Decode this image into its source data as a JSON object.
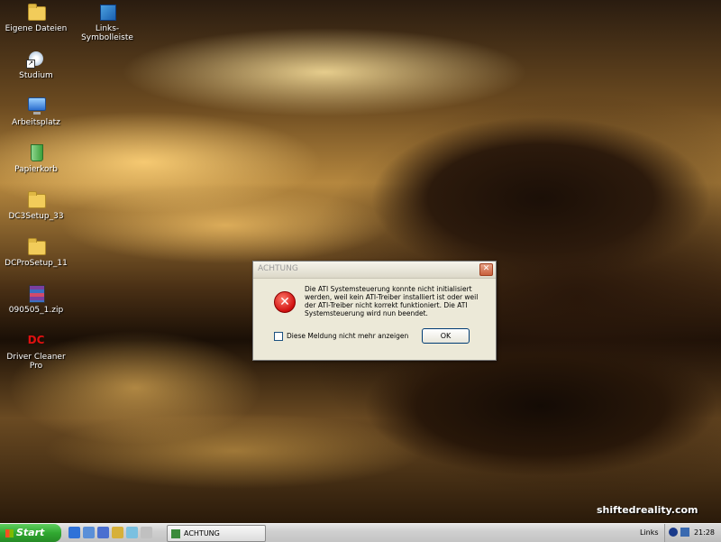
{
  "desktop": {
    "icons": [
      {
        "label": "Eigene Dateien",
        "icon": "folder-icon"
      },
      {
        "label": "Links-Symbolleiste",
        "icon": "shortcut-icon"
      },
      {
        "label": "Studium",
        "icon": "studio-icon"
      },
      {
        "label": "Arbeitsplatz",
        "icon": "computer-icon"
      },
      {
        "label": "Papierkorb",
        "icon": "recycle-bin-icon"
      },
      {
        "label": "DC3Setup_33",
        "icon": "folder-icon"
      },
      {
        "label": "DCProSetup_11",
        "icon": "folder-icon"
      },
      {
        "label": "090505_1.zip",
        "icon": "archive-icon"
      },
      {
        "label": "Driver Cleaner Pro",
        "icon": "driver-cleaner-icon"
      }
    ],
    "watermark": {
      "part1": "shifted",
      "part2": "reality.com"
    }
  },
  "dialog": {
    "title": "ACHTUNG",
    "close_label": "✕",
    "message": "Die ATI Systemsteuerung konnte nicht initialisiert werden, weil kein ATI-Treiber installiert ist oder weil der ATI-Treiber nicht korrekt funktioniert. Die ATI Systemsteuerung wird nun beendet.",
    "checkbox_label": "Diese Meldung nicht mehr anzeigen",
    "ok_label": "OK"
  },
  "taskbar": {
    "start_label": "Start",
    "task_button_label": "ACHTUNG",
    "links_label": "Links",
    "clock": "21:28"
  }
}
